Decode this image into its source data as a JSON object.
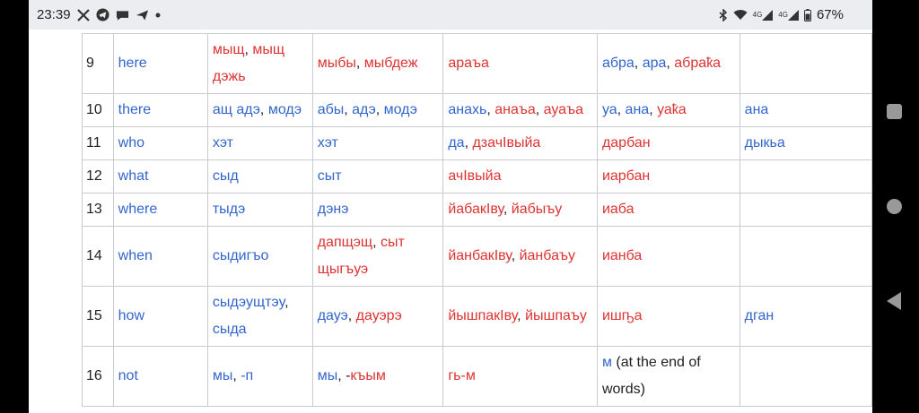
{
  "status": {
    "time": "23:39",
    "battery": "67%",
    "net1": "4G",
    "net2": "4G"
  },
  "rows": [
    {
      "n": "9",
      "en": "here",
      "c1": [
        {
          "t": "мыщ",
          "c": "red"
        },
        {
          "t": ", ",
          "c": "blk"
        },
        {
          "t": "мыщ дэжь",
          "c": "red"
        }
      ],
      "c2": [
        {
          "t": "мыбы",
          "c": "red"
        },
        {
          "t": ", ",
          "c": "blk"
        },
        {
          "t": "мыбдеж",
          "c": "red"
        }
      ],
      "c3": [
        {
          "t": "араъа",
          "c": "red"
        }
      ],
      "c4": [
        {
          "t": "абра",
          "c": "blue"
        },
        {
          "t": ", ",
          "c": "blk"
        },
        {
          "t": "ара",
          "c": "blue"
        },
        {
          "t": ", ",
          "c": "blk"
        },
        {
          "t": "абраҟа",
          "c": "red"
        }
      ],
      "c5": []
    },
    {
      "n": "10",
      "en": "there",
      "c1": [
        {
          "t": "ащ адэ",
          "c": "blue"
        },
        {
          "t": ", ",
          "c": "blk"
        },
        {
          "t": "модэ",
          "c": "blue"
        }
      ],
      "c2": [
        {
          "t": "абы",
          "c": "blue"
        },
        {
          "t": ", ",
          "c": "blk"
        },
        {
          "t": "адэ",
          "c": "blue"
        },
        {
          "t": ", ",
          "c": "blk"
        },
        {
          "t": "модэ",
          "c": "blue"
        }
      ],
      "c3": [
        {
          "t": "анахь",
          "c": "blue"
        },
        {
          "t": ", ",
          "c": "blk"
        },
        {
          "t": "анаъа",
          "c": "red"
        },
        {
          "t": ", ",
          "c": "blk"
        },
        {
          "t": "ауаъа",
          "c": "red"
        }
      ],
      "c4": [
        {
          "t": "уа",
          "c": "blue"
        },
        {
          "t": ", ",
          "c": "blk"
        },
        {
          "t": "ана",
          "c": "blue"
        },
        {
          "t": ", ",
          "c": "blk"
        },
        {
          "t": "уаҟа",
          "c": "red"
        }
      ],
      "c5": [
        {
          "t": "ана",
          "c": "blue"
        }
      ]
    },
    {
      "n": "11",
      "en": "who",
      "c1": [
        {
          "t": "хэт",
          "c": "blue"
        }
      ],
      "c2": [
        {
          "t": "хэт",
          "c": "blue"
        }
      ],
      "c3": [
        {
          "t": "да",
          "c": "blue"
        },
        {
          "t": ", ",
          "c": "blk"
        },
        {
          "t": "дзачӀвыйа",
          "c": "red"
        }
      ],
      "c4": [
        {
          "t": "дарбан",
          "c": "red"
        }
      ],
      "c5": [
        {
          "t": "дыкьа",
          "c": "blue"
        }
      ]
    },
    {
      "n": "12",
      "en": "what",
      "c1": [
        {
          "t": "сыд",
          "c": "blue"
        }
      ],
      "c2": [
        {
          "t": "сыт",
          "c": "blue"
        }
      ],
      "c3": [
        {
          "t": "ачӀвыйа",
          "c": "red"
        }
      ],
      "c4": [
        {
          "t": "иарбан",
          "c": "red"
        }
      ],
      "c5": []
    },
    {
      "n": "13",
      "en": "where",
      "c1": [
        {
          "t": "тыдэ",
          "c": "blue"
        }
      ],
      "c2": [
        {
          "t": "дэнэ",
          "c": "blue"
        }
      ],
      "c3": [
        {
          "t": "йабакӀву",
          "c": "red"
        },
        {
          "t": ", ",
          "c": "blk"
        },
        {
          "t": "йабыъу",
          "c": "red"
        }
      ],
      "c4": [
        {
          "t": "иаба",
          "c": "red"
        }
      ],
      "c5": []
    },
    {
      "n": "14",
      "en": "when",
      "c1": [
        {
          "t": "сыдигъо",
          "c": "blue"
        }
      ],
      "c2": [
        {
          "t": "дапщэщ",
          "c": "red"
        },
        {
          "t": ", ",
          "c": "blk"
        },
        {
          "t": "сыт щыгъуэ",
          "c": "red"
        }
      ],
      "c3": [
        {
          "t": "йанбакӀву",
          "c": "red"
        },
        {
          "t": ", ",
          "c": "blk"
        },
        {
          "t": "йанбаъу",
          "c": "red"
        }
      ],
      "c4": [
        {
          "t": "ианба",
          "c": "red"
        }
      ],
      "c5": []
    },
    {
      "n": "15",
      "en": "how",
      "c1": [
        {
          "t": "сыдэущтэу",
          "c": "blue"
        },
        {
          "t": ", ",
          "c": "blk"
        },
        {
          "t": "сыда",
          "c": "blue"
        }
      ],
      "c2": [
        {
          "t": "дауэ",
          "c": "blue"
        },
        {
          "t": ", ",
          "c": "blk"
        },
        {
          "t": "дауэрэ",
          "c": "red"
        }
      ],
      "c3": [
        {
          "t": "йышпакӀву",
          "c": "red"
        },
        {
          "t": ", ",
          "c": "blk"
        },
        {
          "t": "йышпаъу",
          "c": "red"
        }
      ],
      "c4": [
        {
          "t": "ишҧа",
          "c": "red"
        }
      ],
      "c5": [
        {
          "t": "дган",
          "c": "blue"
        }
      ]
    },
    {
      "n": "16",
      "en": "not",
      "c1": [
        {
          "t": "мы",
          "c": "blue"
        },
        {
          "t": ", ",
          "c": "blk"
        },
        {
          "t": "-п",
          "c": "blue"
        }
      ],
      "c2": [
        {
          "t": "мы",
          "c": "blue"
        },
        {
          "t": ", -",
          "c": "blk"
        },
        {
          "t": "къым",
          "c": "red"
        }
      ],
      "c3": [
        {
          "t": "гь-м",
          "c": "red"
        }
      ],
      "c4": [
        {
          "t": "м",
          "c": "blue"
        },
        {
          "t": " (at the end of words)",
          "c": "blk"
        }
      ],
      "c5": []
    }
  ]
}
